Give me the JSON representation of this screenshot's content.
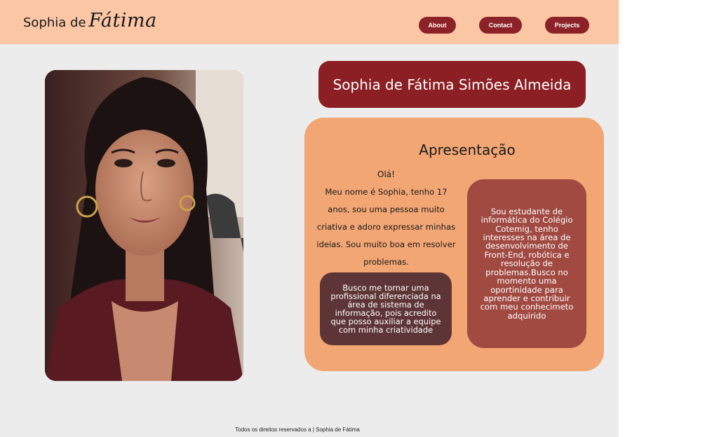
{
  "header": {
    "brand_first": "Sophia de",
    "brand_script": "Fátima",
    "nav": [
      {
        "label": "About"
      },
      {
        "label": "Contact"
      },
      {
        "label": "Projects"
      }
    ]
  },
  "profile": {
    "full_name": "Sophia de Fátima Simões Almeida",
    "photo_alt": "Sophia's portrait photo"
  },
  "intro": {
    "title": "Apresentação",
    "greeting": "Olá!",
    "text": "Meu nome é Sophia, tenho 17 anos, sou uma pessoa muito criativa e adoro expressar minhas ideias. Sou muito boa em resolver problemas.",
    "goal": "Busco me tornar uma profissional diferenciada  na área de sistema de informação, pois acredito que posso auxiliar a equipe com minha criatividade",
    "study": "Sou estudante de informática do Colégio Cotemig, tenho interesses na área de desenvolvimento de Front-End, robótica e resolução de problemas.Busco no momento uma oportinidade para aprender e contribuir com meu conhecimeto adquirido"
  },
  "footer": {
    "text": "Todos os direitos reservados a | Sophia de Fátima"
  },
  "colors": {
    "header_bg": "#fbc6a4",
    "page_bg": "#ececec",
    "accent_dark_red": "#8b1f23",
    "panel_orange": "#f2a674",
    "goal_card": "#5e3536",
    "study_card": "#a04a42"
  }
}
